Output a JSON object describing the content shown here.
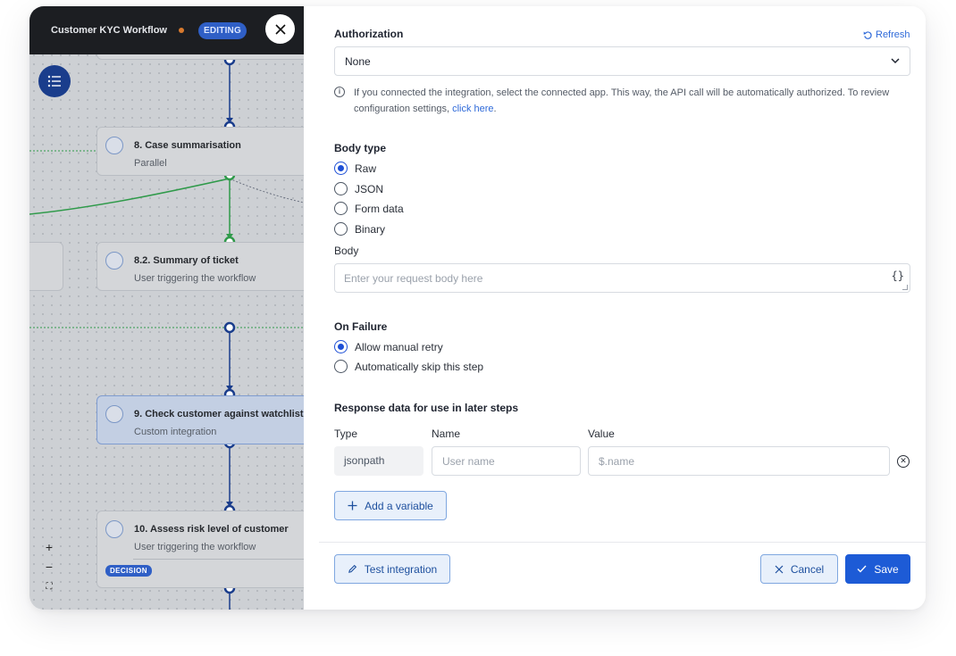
{
  "canvas": {
    "workflow_title": "Customer KYC Workflow",
    "editing_badge": "EDITING",
    "nodes": [
      {
        "title": "8. Case summarisation",
        "subtitle": "Parallel"
      },
      {
        "title": "8.2. Summary of ticket",
        "subtitle": "User triggering the workflow"
      },
      {
        "title": "9. Check customer against watchlist",
        "subtitle": "Custom integration"
      },
      {
        "title": "10. Assess risk level of customer",
        "subtitle": "User triggering the workflow",
        "badge": "DECISION"
      }
    ],
    "zoom": {
      "in": "+",
      "out": "−",
      "fit": "⛶"
    }
  },
  "panel": {
    "authorization": {
      "label": "Authorization",
      "refresh_label": "Refresh",
      "selected": "None",
      "info_text": "If you connected the integration, select the connected app. This way, the API call will be automatically authorized. To review configuration settings, ",
      "info_link": "click here",
      "info_tail": "."
    },
    "body_type": {
      "label": "Body type",
      "options": [
        "Raw",
        "JSON",
        "Form data",
        "Binary"
      ],
      "selected": "Raw"
    },
    "body": {
      "label": "Body",
      "placeholder": "Enter your request body here",
      "braces": "{}"
    },
    "on_failure": {
      "label": "On Failure",
      "options": [
        "Allow manual retry",
        "Automatically skip this step"
      ],
      "selected": "Allow manual retry"
    },
    "response": {
      "label": "Response data for use in later steps",
      "columns": [
        "Type",
        "Name",
        "Value"
      ],
      "row": {
        "type": "jsonpath",
        "name_placeholder": "User name",
        "value_placeholder": "$.name"
      },
      "add_label": "Add a variable"
    },
    "footer": {
      "test_label": "Test integration",
      "cancel_label": "Cancel",
      "save_label": "Save"
    }
  },
  "colors": {
    "primary": "#1d5bd6",
    "link": "#2f6ad9",
    "edge_blue": "#1a3d8c",
    "edge_green": "#2f9a4a",
    "topbar": "#1c1e22",
    "status_dot": "#d97a2e"
  }
}
